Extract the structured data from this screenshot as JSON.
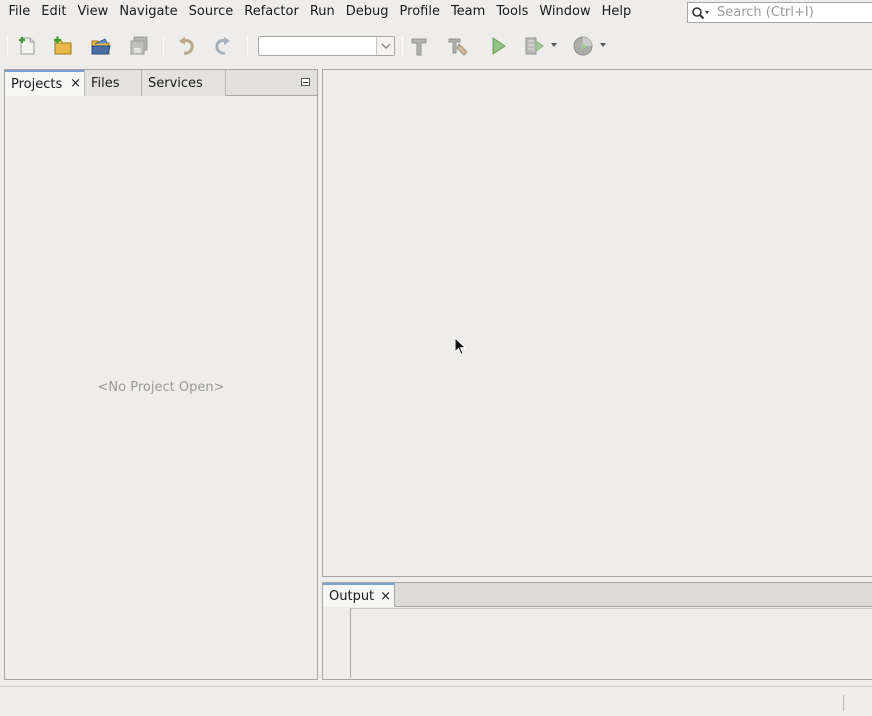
{
  "menu": {
    "items": [
      "File",
      "Edit",
      "View",
      "Navigate",
      "Source",
      "Refactor",
      "Run",
      "Debug",
      "Profile",
      "Team",
      "Tools",
      "Window",
      "Help"
    ]
  },
  "search": {
    "placeholder": "Search (Ctrl+I)",
    "icon": "search-icon"
  },
  "toolbar": {
    "buttons": [
      {
        "name": "new-file",
        "icon": "new-file-icon"
      },
      {
        "name": "new-project",
        "icon": "new-project-icon"
      },
      {
        "name": "open-project",
        "icon": "open-project-icon"
      },
      {
        "name": "save-all",
        "icon": "save-all-icon"
      },
      {
        "name": "undo",
        "icon": "undo-icon"
      },
      {
        "name": "redo",
        "icon": "redo-icon"
      },
      {
        "name": "build",
        "icon": "hammer-icon"
      },
      {
        "name": "clean-build",
        "icon": "clean-build-icon"
      },
      {
        "name": "run",
        "icon": "run-icon"
      },
      {
        "name": "debug",
        "icon": "debug-icon"
      },
      {
        "name": "profile",
        "icon": "profile-icon"
      }
    ],
    "config_value": ""
  },
  "left_panel": {
    "tabs": [
      {
        "label": "Projects",
        "active": true,
        "closable": true
      },
      {
        "label": "Files",
        "active": false,
        "closable": false
      },
      {
        "label": "Services",
        "active": false,
        "closable": false
      }
    ],
    "empty_message": "<No Project Open>"
  },
  "output_panel": {
    "tab_label": "Output",
    "close": "×"
  },
  "close_glyph": "×",
  "colors": {
    "background": "#eeedeb",
    "active_tab_accent": "#7aa0d6",
    "run_green": "#5aa44a",
    "folder_yellow": "#e8b84a"
  }
}
